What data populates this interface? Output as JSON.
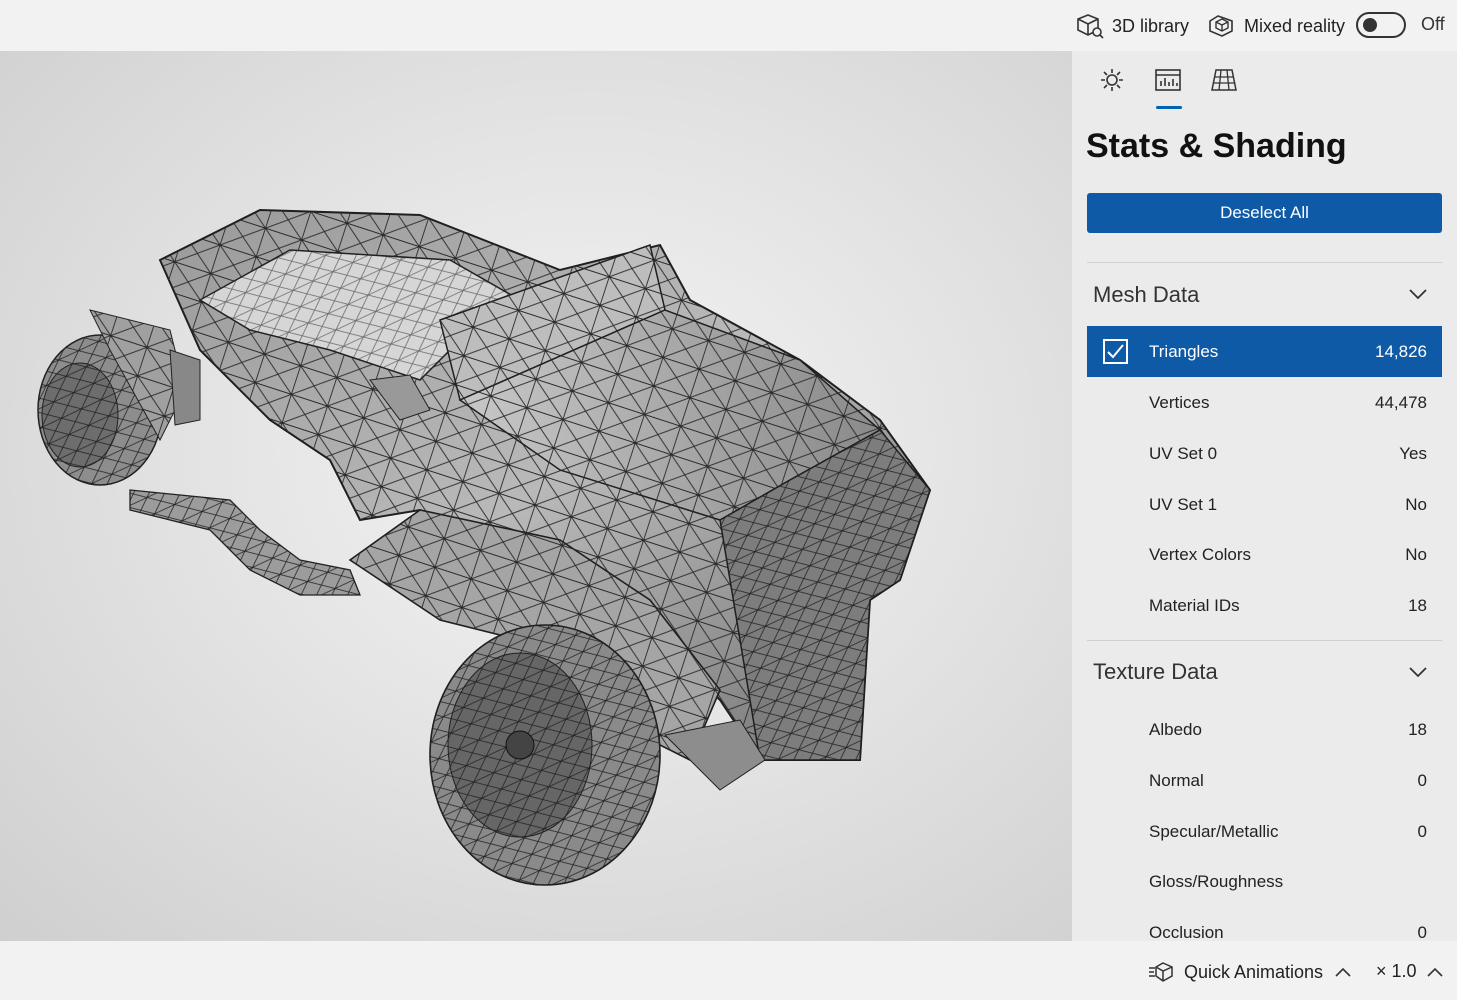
{
  "topbar": {
    "library_label": "3D library",
    "mixed_reality_label": "Mixed reality",
    "mixed_reality_state": "Off"
  },
  "panel": {
    "tabs": [
      {
        "icon": "sun-icon"
      },
      {
        "icon": "stats-icon",
        "active": true
      },
      {
        "icon": "grid-icon"
      }
    ],
    "title": "Stats & Shading",
    "deselect_label": "Deselect All",
    "mesh_header": "Mesh Data",
    "mesh_rows": [
      {
        "label": "Triangles",
        "value": "14,826",
        "selected": true
      },
      {
        "label": "Vertices",
        "value": "44,478"
      },
      {
        "label": "UV Set 0",
        "value": "Yes"
      },
      {
        "label": "UV Set 1",
        "value": "No"
      },
      {
        "label": "Vertex Colors",
        "value": "No"
      },
      {
        "label": "Material IDs",
        "value": "18"
      }
    ],
    "texture_header": "Texture Data",
    "texture_rows": [
      {
        "label": "Albedo",
        "value": "18"
      },
      {
        "label": "Normal",
        "value": "0"
      },
      {
        "label": "Specular/Metallic",
        "value": "0"
      },
      {
        "label": "Gloss/Roughness",
        "value": ""
      },
      {
        "label": "Occlusion",
        "value": "0"
      }
    ]
  },
  "bottombar": {
    "quick_animations_label": "Quick Animations",
    "speed_label": "× 1.0"
  },
  "colors": {
    "accent": "#0f5aa7",
    "panel_bg": "#ebebeb",
    "topbar_bg": "#f2f2f2"
  }
}
